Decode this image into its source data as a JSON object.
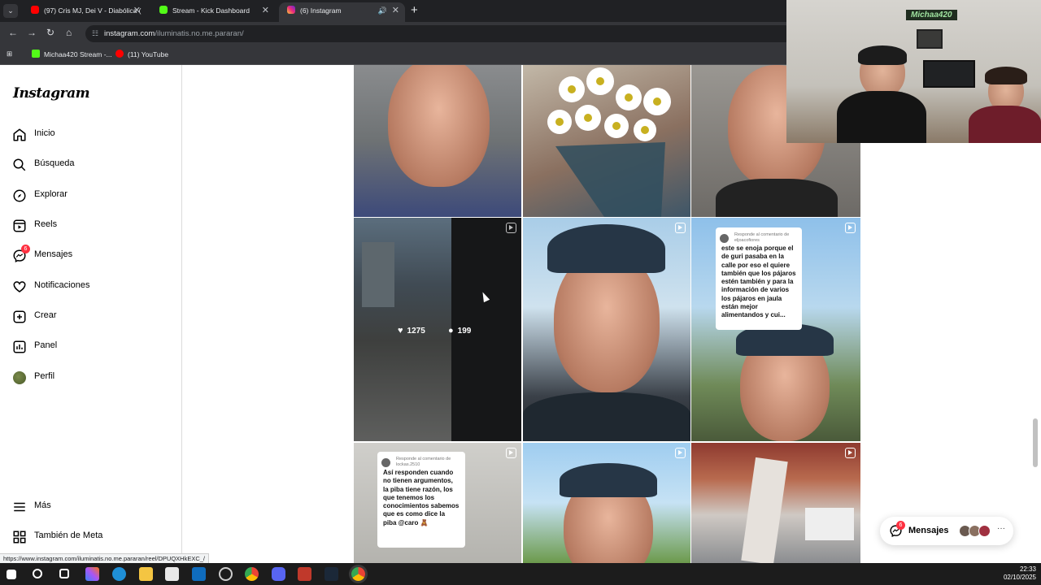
{
  "browser": {
    "tabs": [
      {
        "label": "(97) Cris MJ, Dei V - Diabólica (",
        "icon": "youtube-icon",
        "color": "#ff0000"
      },
      {
        "label": "Stream - Kick Dashboard",
        "icon": "kick-icon",
        "color": "#53fc18"
      },
      {
        "label": "(6) Instagram",
        "icon": "instagram-icon",
        "color": "#d62976"
      }
    ],
    "url_host": "instagram.com",
    "url_path": "/iluminatis.no.me.pararan/",
    "bookmarks": [
      {
        "label": "Michaa420 Stream -...",
        "icon": "kick-icon",
        "color": "#53fc18"
      },
      {
        "label": "(11) YouTube",
        "icon": "youtube-icon",
        "color": "#ff0000"
      }
    ]
  },
  "instagram": {
    "logo": "Instagram",
    "nav": [
      {
        "label": "Inicio",
        "icon": "home-icon"
      },
      {
        "label": "Búsqueda",
        "icon": "search-icon"
      },
      {
        "label": "Explorar",
        "icon": "compass-icon"
      },
      {
        "label": "Reels",
        "icon": "reels-icon"
      },
      {
        "label": "Mensajes",
        "icon": "messenger-icon",
        "badge": "6"
      },
      {
        "label": "Notificaciones",
        "icon": "heart-icon"
      },
      {
        "label": "Crear",
        "icon": "plus-square-icon"
      },
      {
        "label": "Panel",
        "icon": "chart-icon"
      },
      {
        "label": "Perfil",
        "icon": "profile-avatar"
      }
    ],
    "more": {
      "label": "Más",
      "icon": "menu-icon"
    },
    "meta": {
      "label": "También de Meta",
      "icon": "threads-icon"
    },
    "hover_stats": {
      "likes": "1275",
      "comments": "199"
    },
    "comment_cards": [
      {
        "header": "Responde al comentario de eljoacofiores",
        "text": "este se enoja porque el de guri pasaba en la calle por eso el quiere también que los pájaros estén también y para la información de varios los pájaros en jaula están mejor alimentandos y cui..."
      },
      {
        "header": "Responde al comentario de lockas.2510",
        "text": "Así responden cuando no tienen argumentos, la piba tiene razón, los que tenemos los conocimientos sabemos que es como dice la piba @caro 🧸"
      }
    ],
    "messages_pill": {
      "label": "Mensajes",
      "badge": "6"
    }
  },
  "overlay": {
    "cam_tag": "Michaa420"
  },
  "status_url": "https://www.instagram.com/iluminatis.no.me.pararan/reel/DPUQXHkEXC_/",
  "taskbar": {
    "time": "22:33",
    "date": "02/10/2025"
  }
}
